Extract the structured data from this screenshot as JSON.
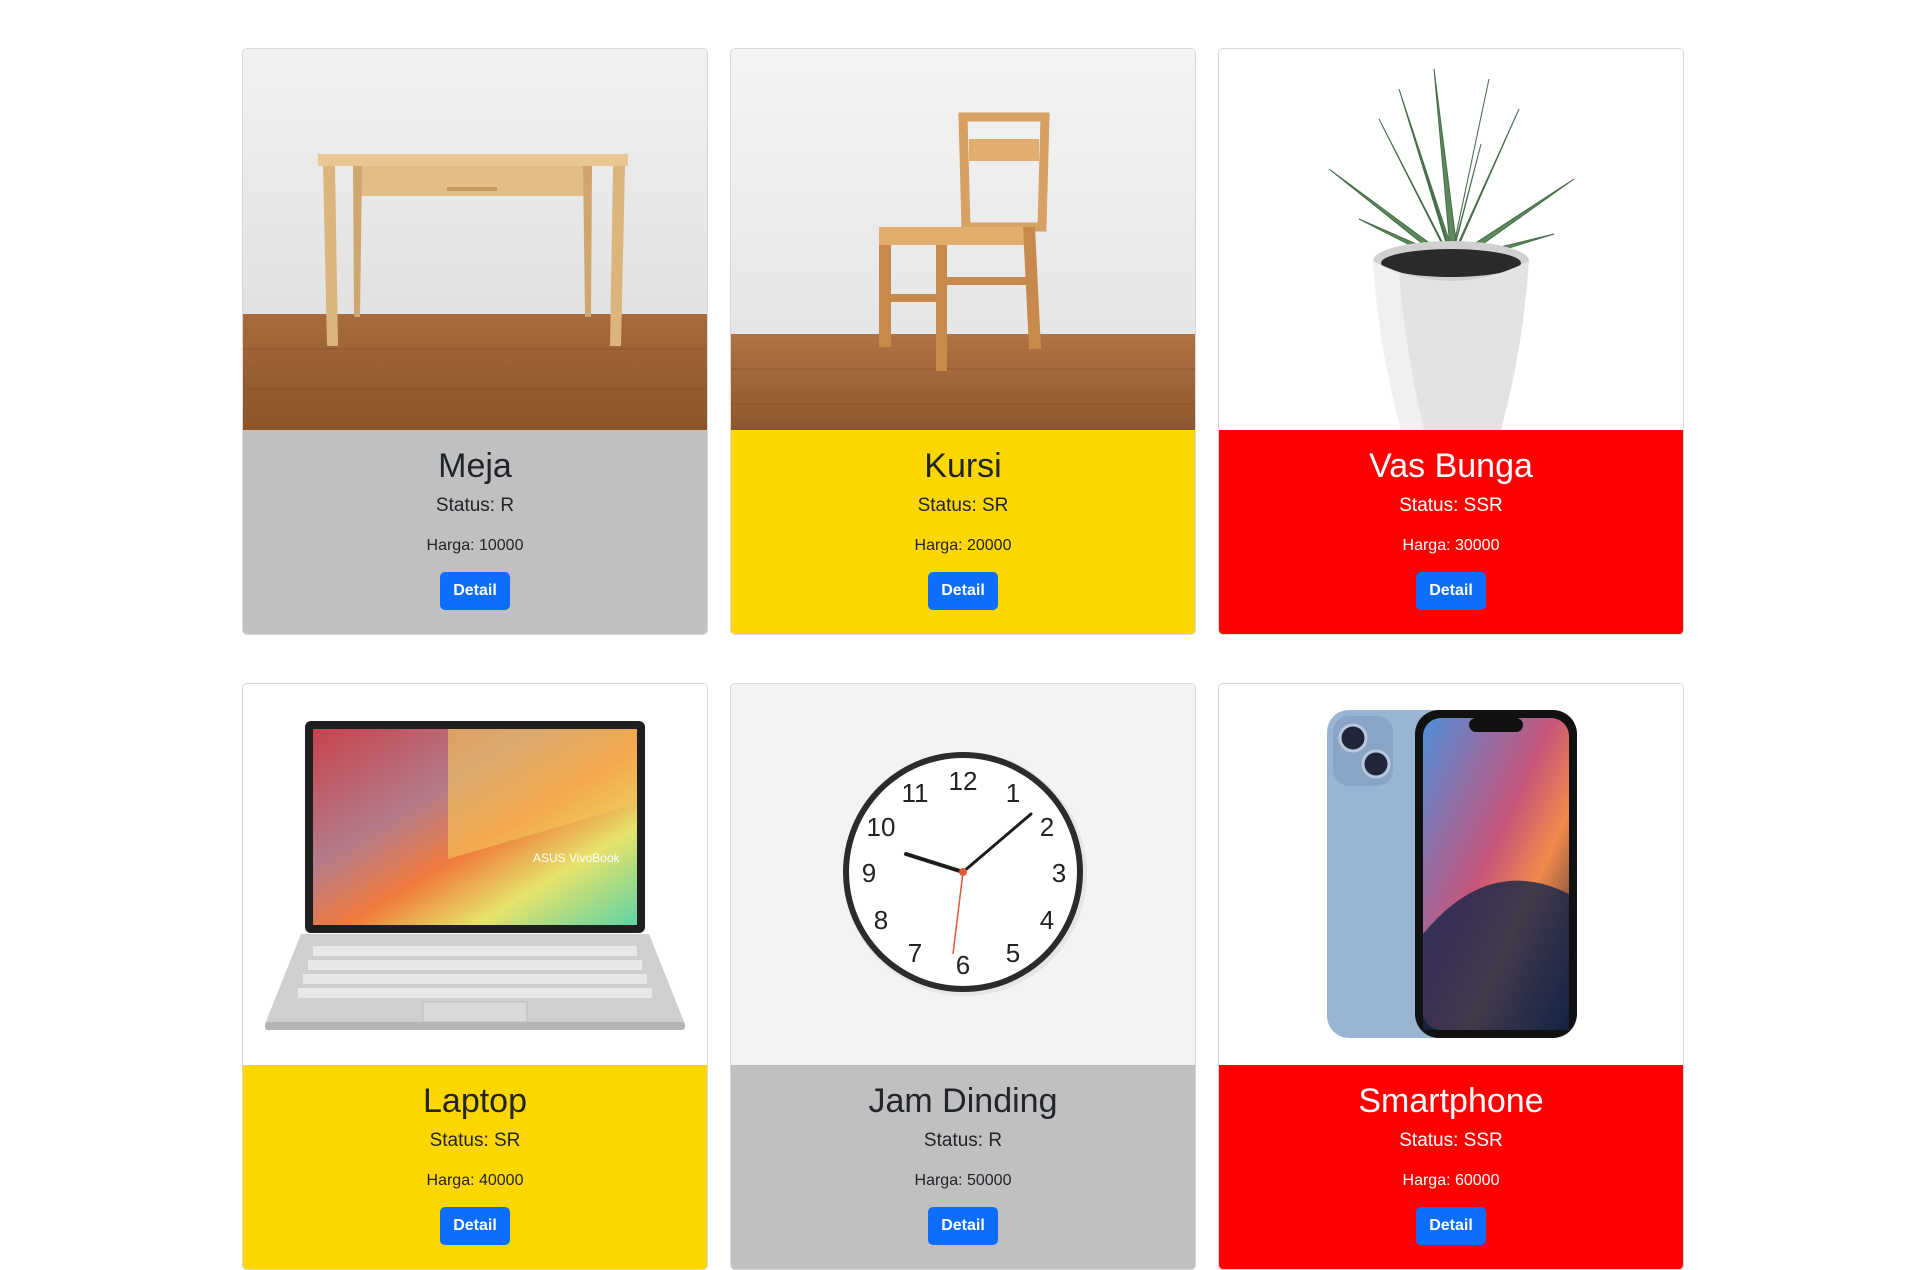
{
  "products": [
    {
      "name": "Meja",
      "status": "Status: R",
      "price": "Harga: 10000",
      "button": "Detail",
      "rarity_color": "#c0c0c0",
      "image": "desk-image"
    },
    {
      "name": "Kursi",
      "status": "Status: SR",
      "price": "Harga: 20000",
      "button": "Detail",
      "rarity_color": "#ffd700",
      "image": "chair-image"
    },
    {
      "name": "Vas Bunga",
      "status": "Status: SSR",
      "price": "Harga: 30000",
      "button": "Detail",
      "rarity_color": "#ff0000",
      "image": "potted-plant-image"
    },
    {
      "name": "Laptop",
      "status": "Status: SR",
      "price": "Harga: 40000",
      "button": "Detail",
      "rarity_color": "#ffd700",
      "image": "laptop-image"
    },
    {
      "name": "Jam Dinding",
      "status": "Status: R",
      "price": "Harga: 50000",
      "button": "Detail",
      "rarity_color": "#c0c0c0",
      "image": "wall-clock-image"
    },
    {
      "name": "Smartphone",
      "status": "Status: SSR",
      "price": "Harga: 60000",
      "button": "Detail",
      "rarity_color": "#ff0000",
      "image": "smartphone-image"
    }
  ],
  "laptop_brand": "ASUS VivoBook",
  "clock_numbers": [
    "12",
    "1",
    "2",
    "3",
    "4",
    "5",
    "6",
    "7",
    "8",
    "9",
    "10",
    "11"
  ]
}
